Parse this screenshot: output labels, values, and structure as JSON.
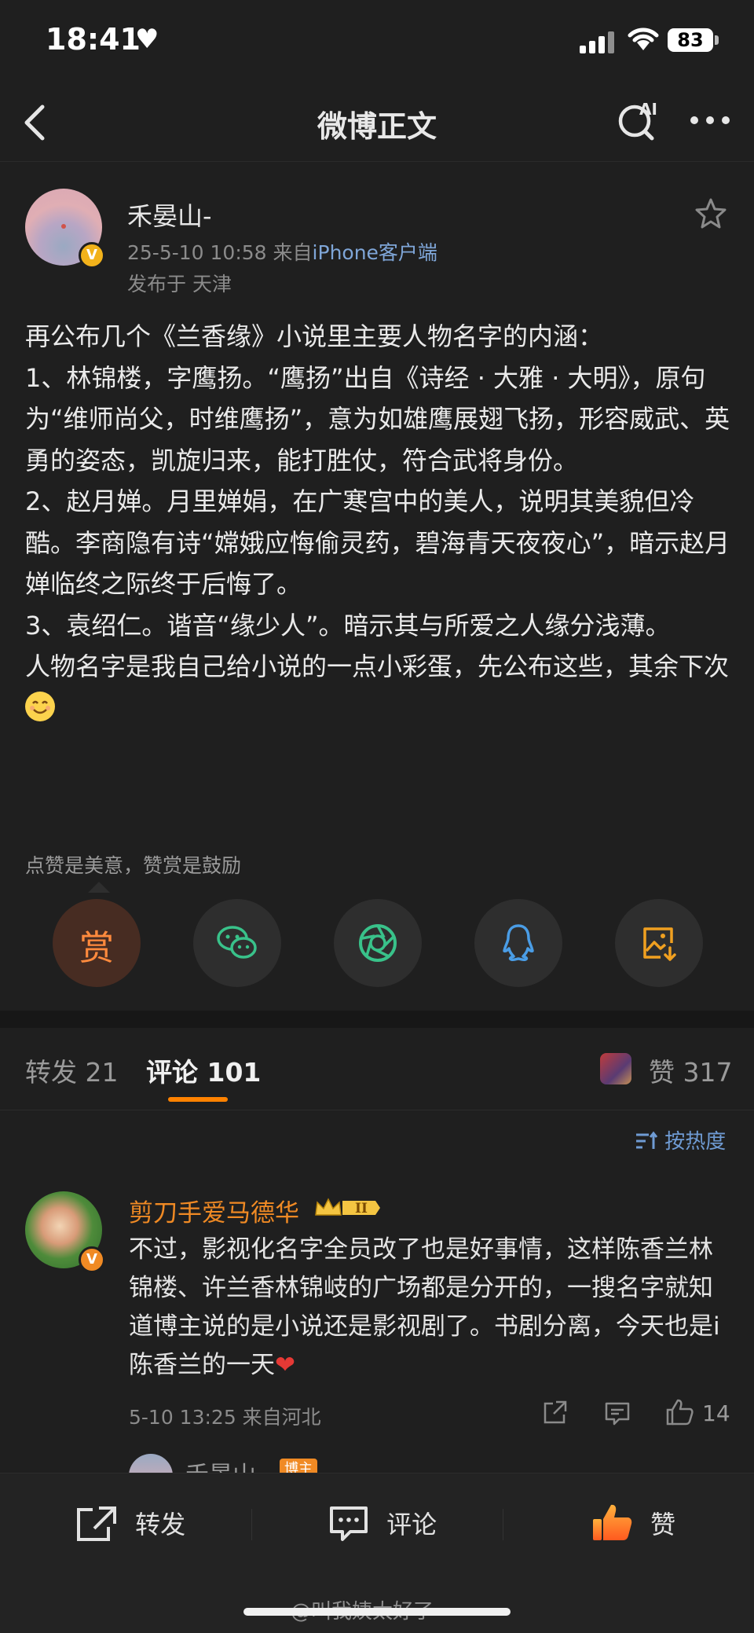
{
  "status_bar": {
    "time": "18:41",
    "battery": "83"
  },
  "nav": {
    "title": "微博正文",
    "ai_label": "AI"
  },
  "post": {
    "author": "禾晏山-",
    "date": "25-5-10 10:58",
    "source_prefix": "来自",
    "source": "iPhone客户端",
    "location": "发布于 天津",
    "paragraphs": [
      "再公布几个《兰香缘》小说里主要人物名字的内涵：",
      "1、林锦楼，字鹰扬。“鹰扬”出自《诗经 · 大雅 · 大明》，原句为“维师尚父，时维鹰扬”，意为如雄鹰展翅飞扬，形容威武、英勇的姿态，凯旋归来，能打胜仗，符合武将身份。",
      "2、赵月婵。月里婵娟，在广寒宫中的美人，说明其美貌但冷酷。李商隐有诗“嫦娥应悔偷灵药，碧海青天夜夜心”，暗示赵月婵临终之际终于后悔了。",
      "3、袁绍仁。谐音“缘少人”。暗示其与所爱之人缘分浅薄。",
      "人物名字是我自己给小说的一点小彩蛋，先公布这些，其余下次"
    ]
  },
  "reward": {
    "text": "点赞是美意，赞赏是鼓励",
    "button_label": "赏"
  },
  "tabs": {
    "repost_label": "转发",
    "repost_count": "21",
    "comment_label": "评论",
    "comment_count": "101",
    "like_label": "赞",
    "like_count": "317"
  },
  "sort": {
    "label": "按热度"
  },
  "comment": {
    "name": "剪刀手爱马德华",
    "level": "II",
    "text": "不过，影视化名字全员改了也是好事情，这样陈香兰林锦楼、许兰香林锦岐的广场都是分开的，一搜名字就知道博主说的是小说还是影视剧了。书剧分离，今天也是i陈香兰的一天",
    "meta": "5-10 13:25 来自河北",
    "like_count": "14",
    "reply_author": "禾晏山-",
    "reply_tag": "博主"
  },
  "bottom_bar": {
    "repost": "转发",
    "comment": "评论",
    "like": "赞"
  },
  "watermark": "@叫我姨太好了",
  "colors": {
    "accent_orange": "#ff8200",
    "link_blue": "#7fa6d8",
    "background": "#1f1f1f"
  }
}
